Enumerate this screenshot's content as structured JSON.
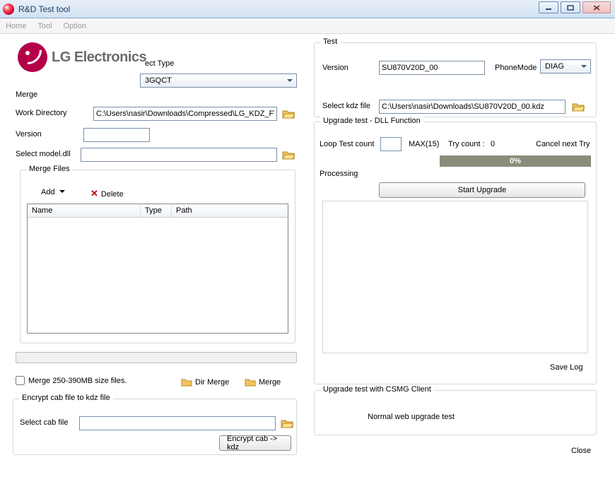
{
  "title": "R&D Test tool",
  "menu": {
    "home": "Home",
    "tool": "Tool",
    "option": "Option"
  },
  "logo": "LG Electronics",
  "sel_type_lbl": "ect Type",
  "sel_type_val": "3GQCT",
  "merge": {
    "legend": "Merge",
    "workdir_lbl": "Work Directory",
    "workdir_val": "C:\\Users\\nasir\\Downloads\\Compressed\\LG_KDZ_FW-U",
    "version_lbl": "Version",
    "version_val": "",
    "modeldll_lbl": "Select model.dll",
    "modeldll_val": ""
  },
  "mergefiles": {
    "legend": "Merge Files",
    "add": "Add",
    "delete": "Delete",
    "col_name": "Name",
    "col_type": "Type",
    "col_path": "Path"
  },
  "merge_opts": {
    "chk_label": "Merge 250-390MB size files.",
    "dir_merge": "Dir Merge",
    "merge": "Merge"
  },
  "encrypt": {
    "legend": "Encrypt cab file to kdz file",
    "sel_lbl": "Select cab file",
    "sel_val": "",
    "btn": "Encrypt cab -> kdz"
  },
  "test": {
    "legend": "Test",
    "version_lbl": "Version",
    "version_val": "SU870V20D_00",
    "phonemode_lbl": "PhoneMode",
    "phonemode_val": "DIAG",
    "selkdz_lbl": "Select kdz file",
    "selkdz_val": "C:\\Users\\nasir\\Downloads\\SU870V20D_00.kdz"
  },
  "upg": {
    "legend": "Upgrade test - DLL Function",
    "loop_lbl": "Loop Test count",
    "loop_val": "",
    "max": "MAX(15)",
    "try_lbl": "Try count :",
    "try_val": "0",
    "cancel": "Cancel next Try",
    "progress": "0%",
    "processing": "Processing",
    "start": "Start Upgrade",
    "savelog": "Save Log"
  },
  "csmg": {
    "legend": "Upgrade test with CSMG Client",
    "text": "Normal web upgrade test"
  },
  "close": "Close"
}
